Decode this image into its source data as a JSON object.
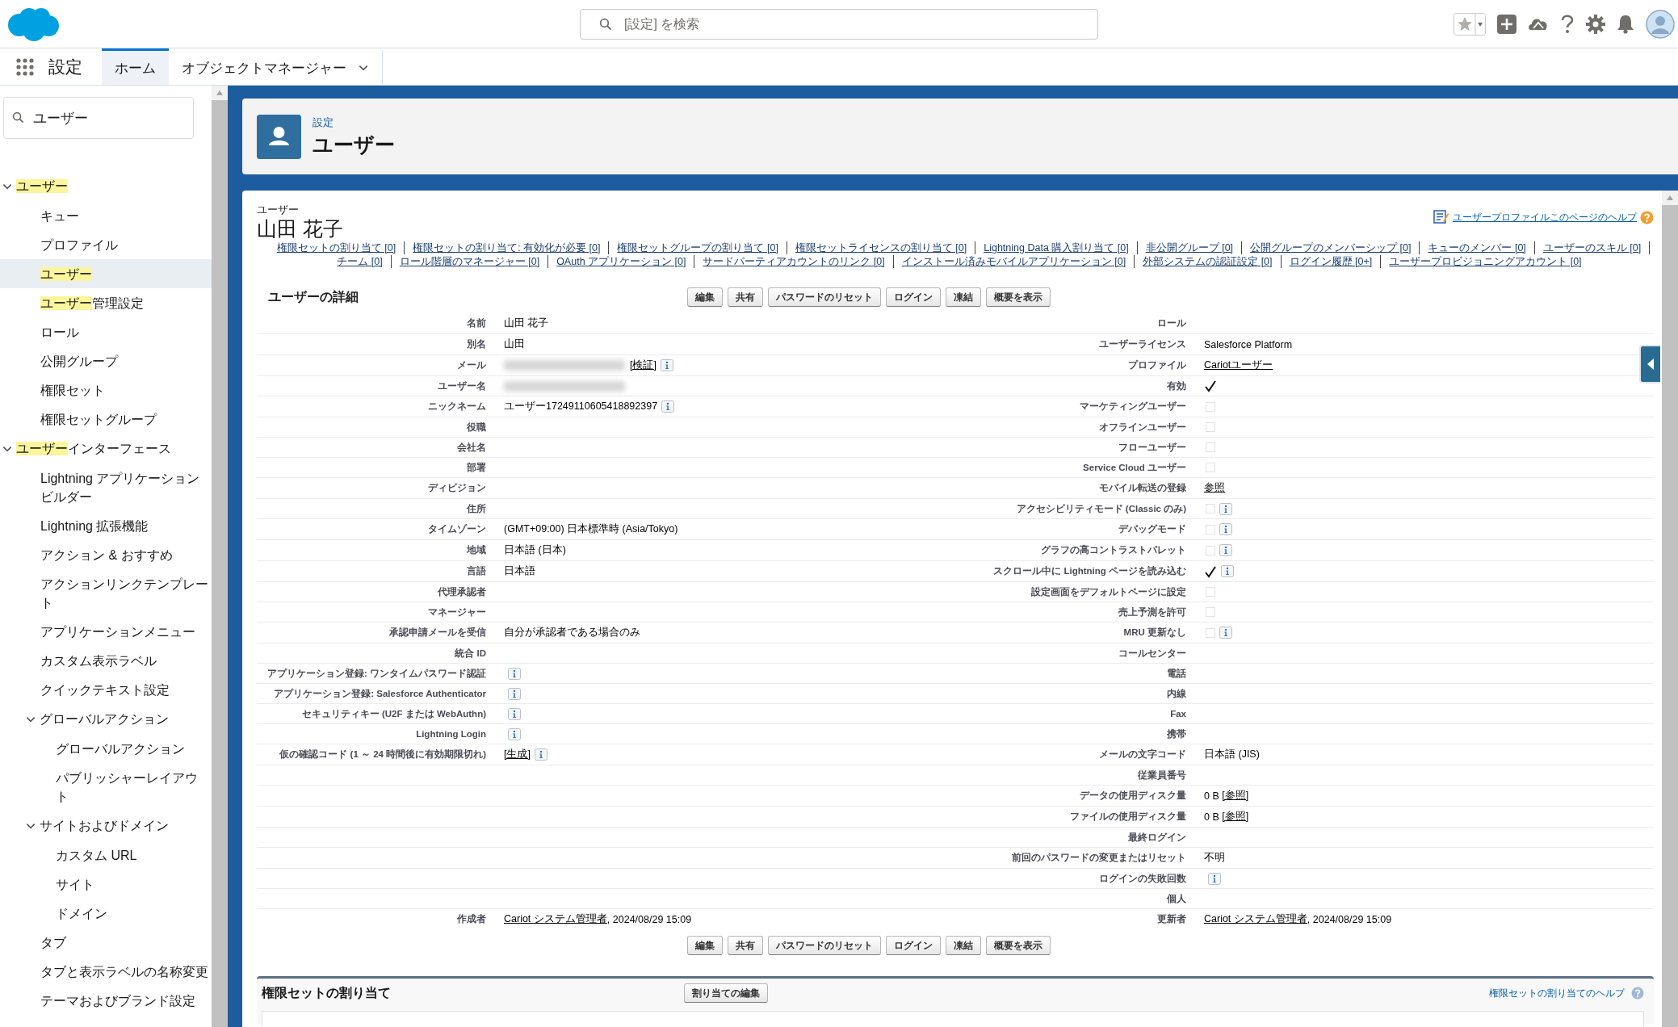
{
  "top_bar": {
    "search": {
      "placeholder": "[設定] を検索"
    }
  },
  "nav": {
    "app_name": "設定",
    "tabs": [
      {
        "label": "ホーム",
        "selected": true,
        "menu": false
      },
      {
        "label": "オブジェクトマネージャー",
        "selected": false,
        "menu": true
      }
    ]
  },
  "sidebar": {
    "search": {
      "value": "ユーザー"
    },
    "items": [
      {
        "parts": [
          {
            "text": "ユーザー",
            "highlighted": true
          }
        ],
        "selected": false,
        "expanded": true,
        "children": [
          {
            "parts": [
              {
                "text": "キュー",
                "highlighted": false
              }
            ],
            "selected": false
          },
          {
            "parts": [
              {
                "text": "プロファイル",
                "highlighted": false
              }
            ],
            "selected": false
          },
          {
            "parts": [
              {
                "text": "ユーザー",
                "highlighted": true
              }
            ],
            "selected": true
          },
          {
            "parts": [
              {
                "text": "ユーザー",
                "highlighted": true
              },
              {
                "text": "管理設定",
                "highlighted": false
              }
            ],
            "selected": false
          },
          {
            "parts": [
              {
                "text": "ロール",
                "highlighted": false
              }
            ],
            "selected": false
          },
          {
            "parts": [
              {
                "text": "公開グループ",
                "highlighted": false
              }
            ],
            "selected": false
          },
          {
            "parts": [
              {
                "text": "権限セット",
                "highlighted": false
              }
            ],
            "selected": false
          },
          {
            "parts": [
              {
                "text": "権限セットグループ",
                "highlighted": false
              }
            ],
            "selected": false
          }
        ]
      },
      {
        "parts": [
          {
            "text": "ユーザー",
            "highlighted": true
          },
          {
            "text": "インターフェース",
            "highlighted": false
          }
        ],
        "selected": false,
        "expanded": true,
        "children": [
          {
            "parts": [
              {
                "text": "Lightning アプリケーションビルダー",
                "highlighted": false
              }
            ],
            "selected": false
          },
          {
            "parts": [
              {
                "text": "Lightning 拡張機能",
                "highlighted": false
              }
            ],
            "selected": false
          },
          {
            "parts": [
              {
                "text": "アクション & おすすめ",
                "highlighted": false
              }
            ],
            "selected": false
          },
          {
            "parts": [
              {
                "text": "アクションリンクテンプレート",
                "highlighted": false
              }
            ],
            "selected": false
          },
          {
            "parts": [
              {
                "text": "アプリケーションメニュー",
                "highlighted": false
              }
            ],
            "selected": false
          },
          {
            "parts": [
              {
                "text": "カスタム表示ラベル",
                "highlighted": false
              }
            ],
            "selected": false
          },
          {
            "parts": [
              {
                "text": "クイックテキスト設定",
                "highlighted": false
              }
            ],
            "selected": false
          },
          {
            "parts": [
              {
                "text": "グローバルアクション",
                "highlighted": false
              }
            ],
            "selected": false,
            "expanded": true,
            "children": [
              {
                "parts": [
                  {
                    "text": "グローバルアクション",
                    "highlighted": false
                  }
                ],
                "selected": false
              },
              {
                "parts": [
                  {
                    "text": "パブリッシャーレイアウト",
                    "highlighted": false
                  }
                ],
                "selected": false
              }
            ]
          },
          {
            "parts": [
              {
                "text": "サイトおよびドメイン",
                "highlighted": false
              }
            ],
            "selected": false,
            "expanded": true,
            "children": [
              {
                "parts": [
                  {
                    "text": "カスタム URL",
                    "highlighted": false
                  }
                ],
                "selected": false
              },
              {
                "parts": [
                  {
                    "text": "サイト",
                    "highlighted": false
                  }
                ],
                "selected": false
              },
              {
                "parts": [
                  {
                    "text": "ドメイン",
                    "highlighted": false
                  }
                ],
                "selected": false
              }
            ]
          },
          {
            "parts": [
              {
                "text": "タブ",
                "highlighted": false
              }
            ],
            "selected": false
          },
          {
            "parts": [
              {
                "text": "タブと表示ラベルの名称変更",
                "highlighted": false
              }
            ],
            "selected": false
          },
          {
            "parts": [
              {
                "text": "テーマおよびブランド設定",
                "highlighted": false
              }
            ],
            "selected": false
          }
        ]
      }
    ]
  },
  "page_header": {
    "breadcrumb": "設定",
    "title": "ユーザー"
  },
  "record": {
    "type": "ユーザー",
    "name": "山田 花子",
    "help_link": "ユーザープロファイルこのページのヘルプ",
    "related_links": [
      "権限セットの割り当て [0]",
      "権限セットの割り当て: 有効化が必要 [0]",
      "権限セットグループの割り当て [0]",
      "権限セットライセンスの割り当て [0]",
      "Lightning Data 購入割り当て [0]",
      "非公開グループ [0]",
      "公開グループのメンバーシップ [0]",
      "キューのメンバー [0]",
      "ユーザーのスキル [0]",
      "チーム [0]",
      "ロール階層のマネージャー [0]",
      "OAuth アプリケーション [0]",
      "サードパーティアカウントのリンク [0]",
      "インストール済みモバイルアプリケーション [0]",
      "外部システムの認証設定 [0]",
      "ログイン履歴 [0+]",
      "ユーザープロビジョニングアカウント [0]"
    ],
    "detail": {
      "title": "ユーザーの詳細",
      "buttons": [
        "編集",
        "共有",
        "パスワードのリセット",
        "ログイン",
        "凍結",
        "概要を表示"
      ],
      "left": [
        {
          "label": "名前",
          "kind": "text",
          "parts": [
            {
              "text": "山田 花子",
              "link": false
            }
          ]
        },
        {
          "label": "別名",
          "kind": "text",
          "parts": [
            {
              "text": "山田",
              "link": false
            }
          ]
        },
        {
          "label": "メール",
          "kind": "redacted",
          "parts": [
            {
              "text": "[検証]",
              "link": true
            }
          ],
          "info": true
        },
        {
          "label": "ユーザー名",
          "kind": "redacted"
        },
        {
          "label": "ニックネーム",
          "kind": "text",
          "parts": [
            {
              "text": "ユーザー17249110605418892397",
              "link": false
            }
          ],
          "info": true
        },
        {
          "label": "役職",
          "kind": "empty"
        },
        {
          "label": "会社名",
          "kind": "empty"
        },
        {
          "label": "部署",
          "kind": "empty"
        },
        {
          "label": "ディビジョン",
          "kind": "empty"
        },
        {
          "label": "住所",
          "kind": "empty"
        },
        {
          "label": "タイムゾーン",
          "kind": "text",
          "parts": [
            {
              "text": "(GMT+09:00) 日本標準時 (Asia/Tokyo)",
              "link": false
            }
          ]
        },
        {
          "label": "地域",
          "kind": "text",
          "parts": [
            {
              "text": "日本語 (日本)",
              "link": false
            }
          ]
        },
        {
          "label": "言語",
          "kind": "text",
          "parts": [
            {
              "text": "日本語",
              "link": false
            }
          ]
        },
        {
          "label": "代理承認者",
          "kind": "empty"
        },
        {
          "label": "マネージャー",
          "kind": "empty"
        },
        {
          "label": "承認申請メールを受信",
          "kind": "text",
          "parts": [
            {
              "text": "自分が承認者である場合のみ",
              "link": false
            }
          ]
        },
        {
          "label": "統合 ID",
          "kind": "empty"
        },
        {
          "label": "アプリケーション登録: ワンタイムパスワード認証",
          "kind": "empty",
          "info": true
        },
        {
          "label": "アプリケーション登録: Salesforce Authenticator",
          "kind": "empty",
          "info": true
        },
        {
          "label": "セキュリティキー (U2F または WebAuthn)",
          "kind": "empty",
          "info": true
        },
        {
          "label": "Lightning Login",
          "kind": "empty",
          "info": true
        },
        {
          "label": "仮の確認コード (1 ～ 24 時間後に有効期限切れ)",
          "kind": "text",
          "parts": [
            {
              "text": "[生成]",
              "link": true
            }
          ],
          "info": true
        }
      ],
      "right": [
        {
          "label": "ロール",
          "kind": "empty"
        },
        {
          "label": "ユーザーライセンス",
          "kind": "text",
          "parts": [
            {
              "text": "Salesforce Platform",
              "link": false
            }
          ]
        },
        {
          "label": "プロファイル",
          "kind": "text",
          "parts": [
            {
              "text": "Cariotユーザー",
              "link": true
            }
          ]
        },
        {
          "label": "有効",
          "kind": "checkbox",
          "checked": true
        },
        {
          "label": "マーケティングユーザー",
          "kind": "checkbox",
          "checked": false
        },
        {
          "label": "オフラインユーザー",
          "kind": "checkbox",
          "checked": false
        },
        {
          "label": "フローユーザー",
          "kind": "checkbox",
          "checked": false
        },
        {
          "label": "Service Cloud ユーザー",
          "kind": "checkbox",
          "checked": false
        },
        {
          "label": "モバイル転送の登録",
          "kind": "text",
          "parts": [
            {
              "text": "参照",
              "link": true
            }
          ]
        },
        {
          "label": "アクセシビリティモード (Classic のみ)",
          "kind": "checkbox",
          "checked": false,
          "info": true
        },
        {
          "label": "デバッグモード",
          "kind": "checkbox",
          "checked": false,
          "info": true
        },
        {
          "label": "グラフの高コントラストパレット",
          "kind": "checkbox",
          "checked": false,
          "info": true
        },
        {
          "label": "スクロール中に Lightning ページを読み込む",
          "kind": "checkbox",
          "checked": true,
          "info": true
        },
        {
          "label": "設定画面をデフォルトページに設定",
          "kind": "checkbox",
          "checked": false
        },
        {
          "label": "売上予測を許可",
          "kind": "checkbox",
          "checked": false
        },
        {
          "label": "MRU 更新なし",
          "kind": "checkbox",
          "checked": false,
          "info": true
        },
        {
          "label": "コールセンター",
          "kind": "empty"
        },
        {
          "label": "電話",
          "kind": "empty"
        },
        {
          "label": "内線",
          "kind": "empty"
        },
        {
          "label": "Fax",
          "kind": "empty"
        },
        {
          "label": "携帯",
          "kind": "empty"
        },
        {
          "label": "メールの文字コード",
          "kind": "text",
          "parts": [
            {
              "text": "日本語 (JIS)",
              "link": false
            }
          ]
        },
        {
          "label": "従業員番号",
          "kind": "empty"
        },
        {
          "label": "データの使用ディスク量",
          "kind": "text",
          "parts": [
            {
              "text": "0 B ",
              "link": false
            },
            {
              "text": "[参照]",
              "link": true
            }
          ]
        },
        {
          "label": "ファイルの使用ディスク量",
          "kind": "text",
          "parts": [
            {
              "text": "0 B ",
              "link": false
            },
            {
              "text": "[参照]",
              "link": true
            }
          ]
        },
        {
          "label": "最終ログイン",
          "kind": "empty"
        },
        {
          "label": "前回のパスワードの変更またはリセット",
          "kind": "text",
          "parts": [
            {
              "text": "不明",
              "link": false
            }
          ]
        },
        {
          "label": "ログインの失敗回数",
          "kind": "empty",
          "info": true
        },
        {
          "label": "個人",
          "kind": "empty"
        }
      ],
      "footer": {
        "left": {
          "label": "作成者",
          "kind": "text",
          "parts": [
            {
              "text": "Cariot システム管理者",
              "link": true
            },
            {
              "text": ", 2024/08/29 15:09",
              "link": false
            }
          ]
        },
        "right": {
          "label": "更新者",
          "kind": "text",
          "parts": [
            {
              "text": "Cariot システム管理者",
              "link": true
            },
            {
              "text": ", 2024/08/29 15:09",
              "link": false
            }
          ]
        }
      },
      "bottom_buttons": [
        "編集",
        "共有",
        "パスワードのリセット",
        "ログイン",
        "凍結",
        "概要を表示"
      ]
    }
  },
  "permission_sets": {
    "title": "権限セットの割り当て",
    "button": "割り当ての編集",
    "help_link": "権限セットの割り当てのヘルプ"
  }
}
